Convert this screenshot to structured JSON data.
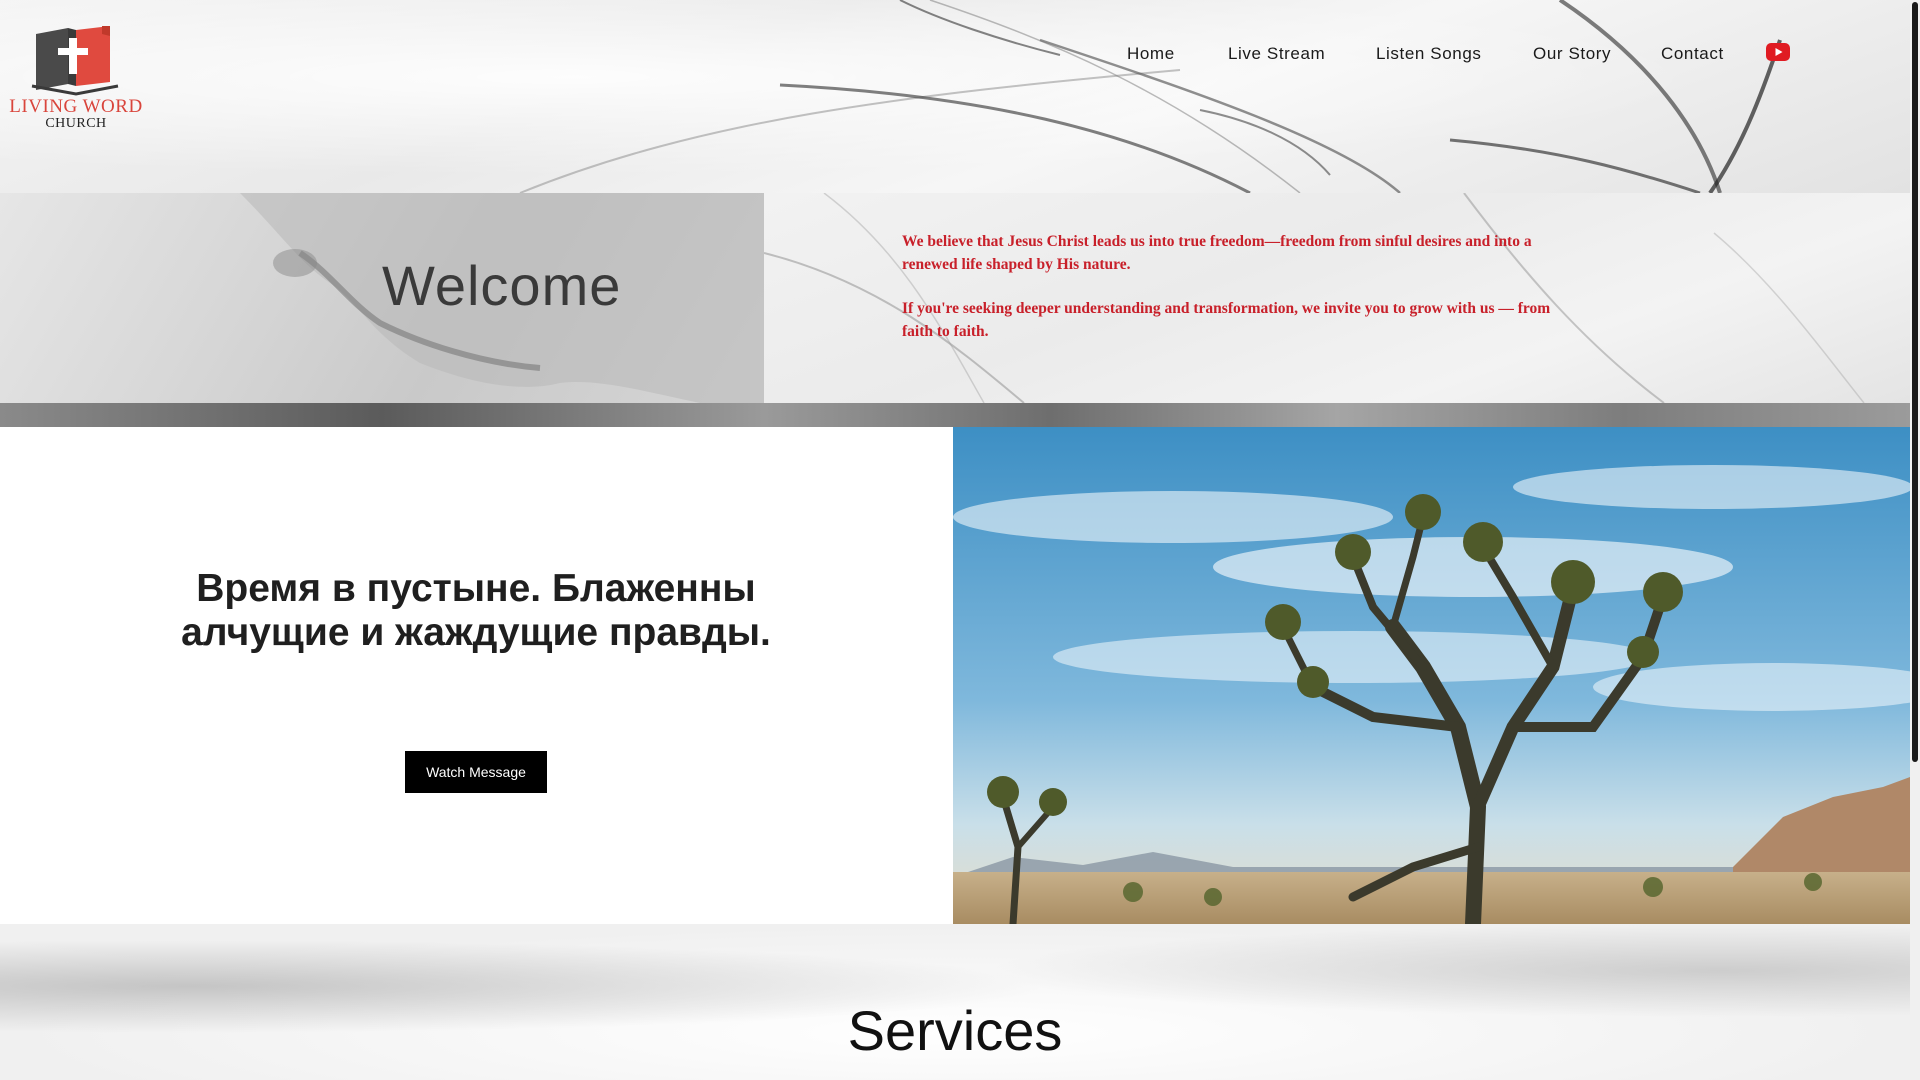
{
  "logo": {
    "line1": "LIVING WORD",
    "line2": "CHURCH",
    "accent_color": "#d9453c"
  },
  "nav": {
    "items": [
      {
        "label": "Home"
      },
      {
        "label": "Live Stream"
      },
      {
        "label": "Listen Songs"
      },
      {
        "label": "Our Story"
      },
      {
        "label": "Contact"
      }
    ],
    "youtube_icon": "youtube-icon",
    "youtube_color": "#e01b22"
  },
  "welcome": {
    "title": "Welcome",
    "paragraphs": [
      "We believe that Jesus Christ leads us into true freedom—freedom from sinful desires and into a renewed life shaped by His nature.",
      "If you're seeking deeper understanding and transformation, we invite you to grow with us — from faith to faith."
    ],
    "text_color": "#c8202a"
  },
  "sermon": {
    "title": "Время в пустыне. Блаженны алчущие и жаждущие правды.",
    "button_label": "Watch Message",
    "photo_icon": "joshua-tree-photo"
  },
  "services": {
    "title": "Services"
  }
}
